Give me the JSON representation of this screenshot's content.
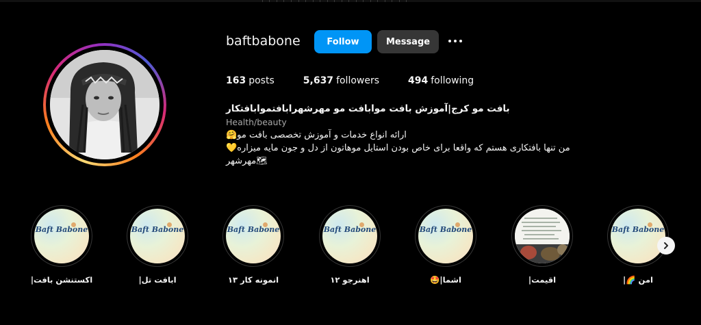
{
  "profile": {
    "username": "baftbabone",
    "follow_label": "Follow",
    "message_label": "Message",
    "stats": {
      "posts_count": "163",
      "posts_label": "posts",
      "followers_count": "5,637",
      "followers_label": "followers",
      "following_count": "494",
      "following_label": "following"
    },
    "bio": {
      "title": "بافت مو کرج|آموزش بافت موابافت مو مهرشهرابافتموابافتکار",
      "category": "Health/beauty",
      "line1": "ارائه انواع خدمات و آموزش تخصصی بافت مو🤗",
      "line2": "من تنها بافتکاری هستم که واقعا برای خاص بودن استایل موهاتون از دل و جون مایه میزاره💛",
      "line3": "🗺مهرشهر"
    }
  },
  "highlights": [
    {
      "label": "اکستنشن بافت|",
      "image_text": "Baft Babone"
    },
    {
      "label": "ابافت تل|",
      "image_text": "Baft Babone"
    },
    {
      "label": "انمونه کار ۱۳",
      "image_text": "Baft Babone"
    },
    {
      "label": "اهنرجو ۱۲",
      "image_text": "Baft Babone"
    },
    {
      "label": "اشما|🤩",
      "image_text": "Baft Babone"
    },
    {
      "label": "اقیمت|",
      "image_text": ""
    },
    {
      "label": "امن 🌈|",
      "image_text": "Baft Babone"
    }
  ],
  "icons": {
    "more": "more-options-icon",
    "next": "chevron-right-icon"
  },
  "colors": {
    "background": "#000000",
    "follow_button": "#0095f6",
    "message_button": "#363636",
    "text": "#f5f5f5",
    "muted": "#a8a8a8"
  }
}
